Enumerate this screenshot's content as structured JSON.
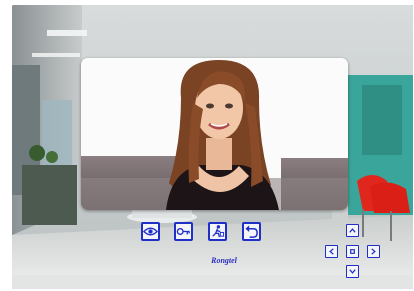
{
  "brand": {
    "label": "Rongtel"
  },
  "toolbar": {
    "buttons": [
      {
        "icon": "eye-icon"
      },
      {
        "icon": "key-icon"
      },
      {
        "icon": "unlock-person-icon"
      },
      {
        "icon": "back-arrow-icon"
      }
    ]
  },
  "navpad": {
    "buttons": [
      {
        "icon": "chevron-up-icon"
      },
      {
        "icon": "chevron-left-icon"
      },
      {
        "icon": "center-square-icon"
      },
      {
        "icon": "chevron-right-icon"
      },
      {
        "icon": "chevron-down-icon"
      }
    ]
  },
  "colors": {
    "accent": "#1f2fc8",
    "brand_text": "#2a2ec0"
  }
}
